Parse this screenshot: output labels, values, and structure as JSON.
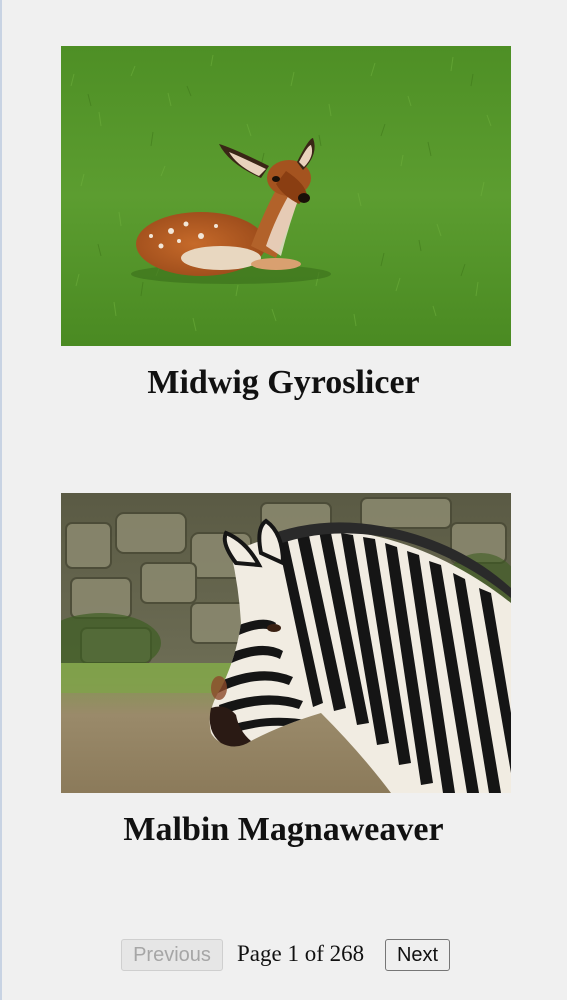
{
  "cards": [
    {
      "title": "Midwig Gyroslicer",
      "image_subject": "young deer fawn lying in grass"
    },
    {
      "title": "Malbin Magnaweaver",
      "image_subject": "zebra head in profile before stone wall"
    }
  ],
  "pagination": {
    "previous_label": "Previous",
    "page_info": "Page 1 of 268",
    "next_label": "Next",
    "previous_disabled": true
  },
  "colors": {
    "background": "#f0f0f0",
    "grass": "#5a9a2e",
    "text": "#111111"
  }
}
